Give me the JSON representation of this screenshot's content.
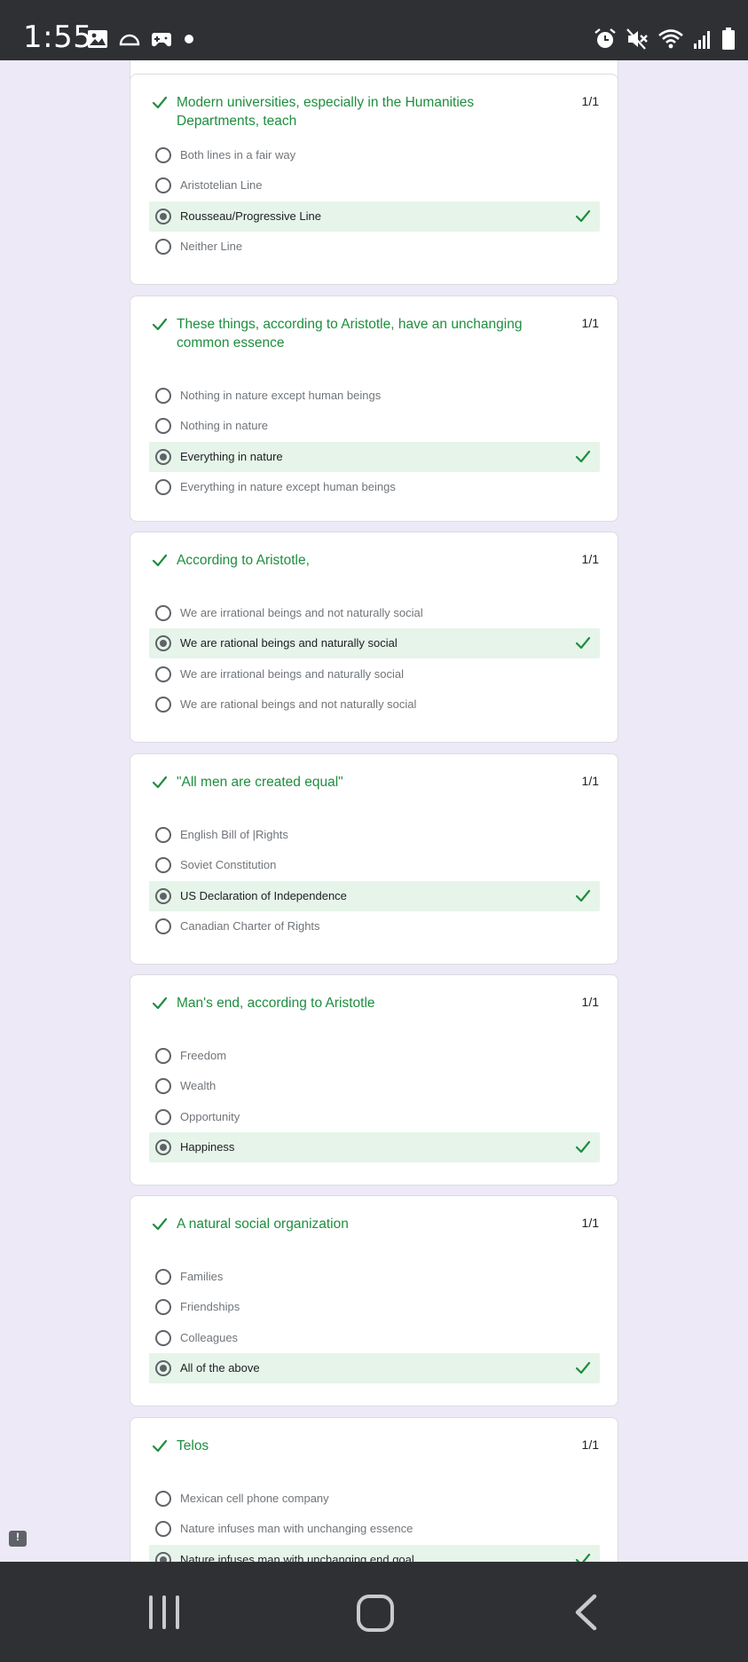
{
  "status_bar": {
    "time": "1:55",
    "left_icons": [
      "image-icon",
      "half-circle-icon",
      "game-controller-icon",
      "dot-icon"
    ],
    "right_icons": [
      "alarm-icon",
      "mute-icon",
      "wifi-icon",
      "signal-icon",
      "battery-icon"
    ]
  },
  "questions": [
    {
      "title": "Modern universities, especially in the Humanities Departments, teach",
      "points": "1/1",
      "options": [
        {
          "label": "Both lines in a fair way",
          "selected": false,
          "correct": false
        },
        {
          "label": "Aristotelian Line",
          "selected": false,
          "correct": false
        },
        {
          "label": "Rousseau/Progressive Line",
          "selected": true,
          "correct": true
        },
        {
          "label": "Neither Line",
          "selected": false,
          "correct": false
        }
      ]
    },
    {
      "title": "These things, according to Aristotle, have an unchanging common essence",
      "points": "1/1",
      "options": [
        {
          "label": "Nothing in nature except human beings",
          "selected": false,
          "correct": false
        },
        {
          "label": "Nothing in nature",
          "selected": false,
          "correct": false
        },
        {
          "label": "Everything in nature",
          "selected": true,
          "correct": true
        },
        {
          "label": "Everything in nature except human beings",
          "selected": false,
          "correct": false
        }
      ]
    },
    {
      "title": "According to Aristotle,",
      "points": "1/1",
      "options": [
        {
          "label": "We are irrational beings and not naturally social",
          "selected": false,
          "correct": false
        },
        {
          "label": "We are rational beings and naturally social",
          "selected": true,
          "correct": true
        },
        {
          "label": "We are irrational beings and naturally social",
          "selected": false,
          "correct": false
        },
        {
          "label": "We are rational beings and not naturally social",
          "selected": false,
          "correct": false
        }
      ]
    },
    {
      "title": "\"All men are created equal\"",
      "points": "1/1",
      "options": [
        {
          "label": "English Bill of |Rights",
          "selected": false,
          "correct": false
        },
        {
          "label": "Soviet Constitution",
          "selected": false,
          "correct": false
        },
        {
          "label": "US Declaration of Independence",
          "selected": true,
          "correct": true
        },
        {
          "label": "Canadian Charter of Rights",
          "selected": false,
          "correct": false
        }
      ]
    },
    {
      "title": "Man's end, according to Aristotle",
      "points": "1/1",
      "options": [
        {
          "label": "Freedom",
          "selected": false,
          "correct": false
        },
        {
          "label": "Wealth",
          "selected": false,
          "correct": false
        },
        {
          "label": "Opportunity",
          "selected": false,
          "correct": false
        },
        {
          "label": "Happiness",
          "selected": true,
          "correct": true
        }
      ]
    },
    {
      "title": "A natural social organization",
      "points": "1/1",
      "options": [
        {
          "label": "Families",
          "selected": false,
          "correct": false
        },
        {
          "label": "Friendships",
          "selected": false,
          "correct": false
        },
        {
          "label": "Colleagues",
          "selected": false,
          "correct": false
        },
        {
          "label": "All of the above",
          "selected": true,
          "correct": true
        }
      ]
    },
    {
      "title": "Telos",
      "points": "1/1",
      "options": [
        {
          "label": "Mexican cell phone company",
          "selected": false,
          "correct": false
        },
        {
          "label": "Nature infuses man with unchanging essence",
          "selected": false,
          "correct": false
        },
        {
          "label": "Nature infuses man with unchanging end goal",
          "selected": true,
          "correct": true
        }
      ]
    }
  ],
  "colors": {
    "accent_green": "#1e8e3e",
    "correct_bg": "#e6f4ea",
    "page_bg": "#ede9f7",
    "system_bar": "#2f3034"
  },
  "nav_bar": {
    "buttons": [
      "recent-apps-icon",
      "home-icon",
      "back-icon"
    ]
  }
}
